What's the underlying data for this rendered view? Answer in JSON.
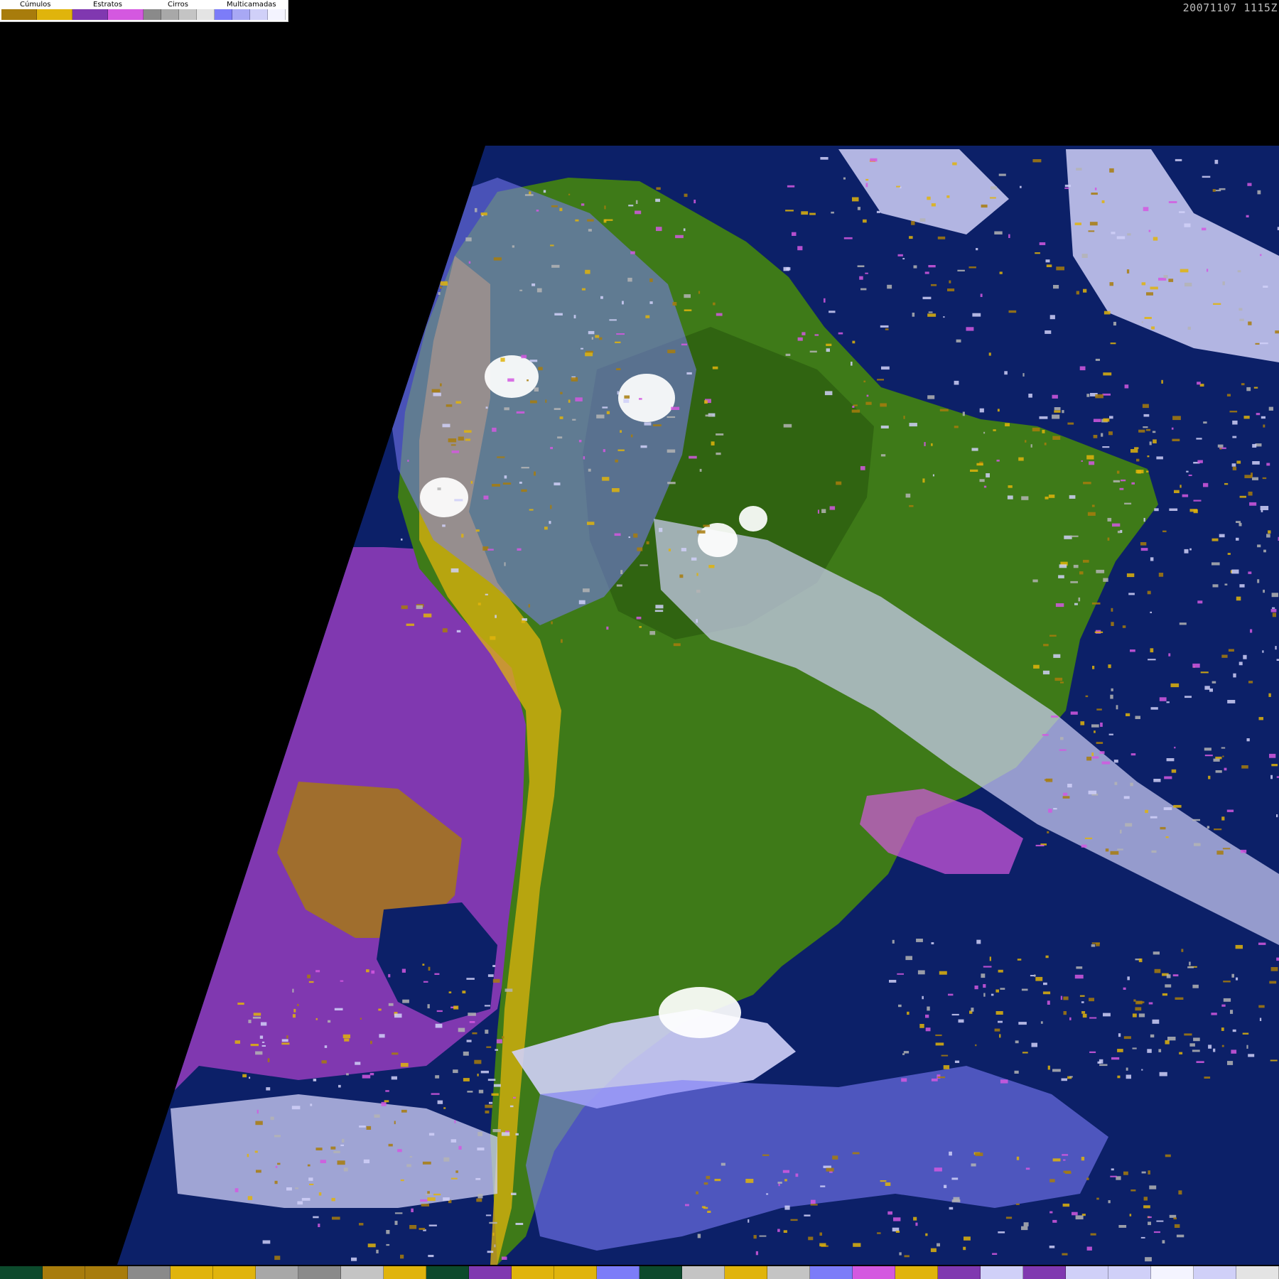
{
  "timestamp": "20071107 1115Z",
  "legend": {
    "groups": [
      {
        "label": "Cúmulos",
        "colors": [
          "#a87c0c",
          "#e0b40c"
        ]
      },
      {
        "label": "Estratos",
        "colors": [
          "#8038b0",
          "#d458e0"
        ]
      },
      {
        "label": "Cirros",
        "colors": [
          "#8a8a8a",
          "#a8a8a8",
          "#c4c4c4",
          "#e4e4e4"
        ]
      },
      {
        "label": "Multicamadas",
        "colors": [
          "#7c7cf8",
          "#a8a8f4",
          "#d0d0f8",
          "#f4f4ff"
        ]
      }
    ]
  },
  "map": {
    "region": "South America",
    "colors": {
      "space": "#000000",
      "ocean": "#0c2068",
      "land": "#3e7a18",
      "land_dark": "#2e6010",
      "pacific_stratus": "#8038b0",
      "cumulus_dark": "#a87c0c",
      "cumulus_light": "#e0b40c",
      "stratus_light": "#d458e0",
      "multilayer": "#7c7cf8",
      "multilayer_light": "#d0d0f8",
      "cirrus": "#b4b4b4",
      "white": "#ffffff"
    }
  },
  "bottom_strip": {
    "colors": [
      "#0c4a2c",
      "#a87c0c",
      "#a87c0c",
      "#8a8a8a",
      "#e0b40c",
      "#e0b40c",
      "#a8a8a8",
      "#8a8a8a",
      "#c4c4c4",
      "#e0b40c",
      "#0c4a2c",
      "#8038b0",
      "#e0b40c",
      "#e0b40c",
      "#7c7cf8",
      "#0c4a2c",
      "#c4c4c4",
      "#e0b40c",
      "#c4c4c4",
      "#7c7cf8",
      "#d458e0",
      "#e0b40c",
      "#8038b0",
      "#d0d0f8",
      "#8038b0",
      "#d0d0f8",
      "#d0d0f8",
      "#f4f4ff",
      "#d0d0f8",
      "#e4e4e4"
    ]
  }
}
